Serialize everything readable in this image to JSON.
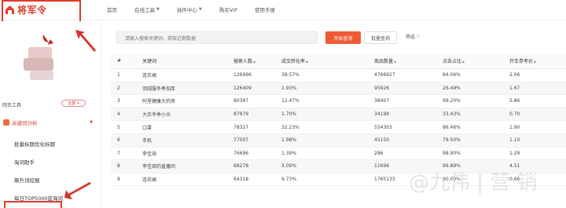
{
  "brand": {
    "name": "将军令"
  },
  "nav": [
    {
      "label": "首页",
      "has_dropdown": false
    },
    {
      "label": "在线工具",
      "has_dropdown": true
    },
    {
      "label": "插件中心",
      "has_dropdown": true
    },
    {
      "label": "购买VIP",
      "has_dropdown": false
    },
    {
      "label": "使用手册",
      "has_dropdown": false
    }
  ],
  "sidebar": {
    "tools_label": "网页工具",
    "select_value": "全部",
    "group_label": "关键词分析",
    "links": [
      "批量标题优化标题",
      "淘词助手",
      "飙升词挖掘",
      "每日TOP5000蓝海词"
    ]
  },
  "search": {
    "placeholder": "请输入搜索关键词，获取近期数据",
    "primary_label": "开始查询",
    "batch_label": "批量查询",
    "filter_label": "筛选"
  },
  "table": {
    "headers": [
      "#",
      "关键词",
      "搜索人数",
      "成交转化率",
      "商品数量",
      "点击占比",
      "开车参考价"
    ],
    "rows": [
      [
        "1",
        "连衣裙",
        "126996",
        "38.57%",
        "4766927",
        "84.06%",
        "2.06"
      ],
      [
        "2",
        "羽绒服冬季加厚",
        "126409",
        "1.93%",
        "95926",
        "26.49%",
        "1.67"
      ],
      [
        "3",
        "阿里健康大药房",
        "80397",
        "12.47%",
        "38407",
        "99.20%",
        "5.86"
      ],
      [
        "4",
        "大衣冬季小众",
        "87979",
        "1.70%",
        "34199",
        "33.43%",
        "0.70"
      ],
      [
        "5",
        "口罩",
        "78327",
        "32.23%",
        "554303",
        "86.46%",
        "1.90"
      ],
      [
        "6",
        "手机",
        "77007",
        "1.98%",
        "45150",
        "79.50%",
        "1.10"
      ],
      [
        "7",
        "李佳琦",
        "76696",
        "1.39%",
        "286",
        "98.90%",
        "1.29"
      ],
      [
        "8",
        "李佳琦的直播间",
        "68278",
        "3.09%",
        "11696",
        "99.89%",
        "4.51"
      ],
      [
        "9",
        "连衣裙",
        "64318",
        "9.73%",
        "1765133",
        "90.00%",
        "0.66"
      ]
    ]
  },
  "watermark": "@九伟 | 营 销"
}
